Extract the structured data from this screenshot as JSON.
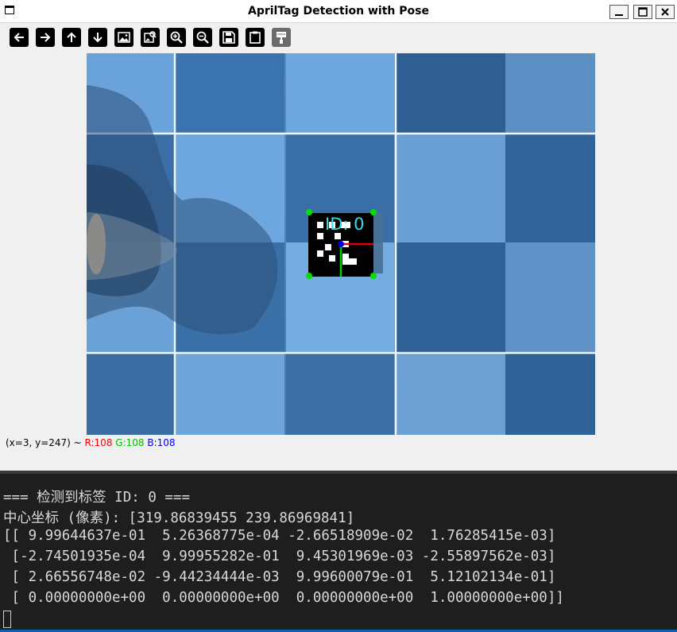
{
  "window": {
    "title": "AprilTag Detection with Pose",
    "controls": [
      "minimize",
      "maximize",
      "close"
    ]
  },
  "toolbar": {
    "buttons": [
      {
        "id": "pan-left",
        "icon": "arrow-left-icon",
        "enabled": true
      },
      {
        "id": "pan-right",
        "icon": "arrow-right-icon",
        "enabled": true
      },
      {
        "id": "pan-up",
        "icon": "arrow-up-icon",
        "enabled": true
      },
      {
        "id": "pan-down",
        "icon": "arrow-down-icon",
        "enabled": true
      },
      {
        "id": "zoom-fit",
        "icon": "image-icon",
        "enabled": true
      },
      {
        "id": "zoom-original",
        "icon": "image-search-icon",
        "enabled": true
      },
      {
        "id": "zoom-in",
        "icon": "zoom-in-icon",
        "enabled": true
      },
      {
        "id": "zoom-out",
        "icon": "zoom-out-icon",
        "enabled": true
      },
      {
        "id": "save",
        "icon": "save-icon",
        "enabled": true
      },
      {
        "id": "copy",
        "icon": "clipboard-icon",
        "enabled": true
      },
      {
        "id": "properties",
        "icon": "paint-brush-icon",
        "enabled": false
      }
    ]
  },
  "image": {
    "tag_label": "ID: 0",
    "colors": {
      "corner": "#00e000",
      "axis_x": "#e00000",
      "axis_y": "#00d000",
      "axis_z": "#0000e0",
      "label": "#33ddee"
    }
  },
  "status": {
    "coords": "(x=3, y=247) ~ ",
    "r": "R:108",
    "g": "G:108",
    "b": "B:108",
    "colors": {
      "r": "#ff0000",
      "g": "#00c000",
      "b": "#0000ff"
    }
  },
  "terminal": {
    "lines": [
      "=== 检测到标签 ID: 0 ===",
      "中心坐标 (像素): [319.86839455 239.86969841]",
      "[[ 9.99644637e-01  5.26368775e-04 -2.66518909e-02  1.76285415e-03]",
      " [-2.74501935e-04  9.99955282e-01  9.45301969e-03 -2.55897562e-03]",
      " [ 2.66556748e-02 -9.44234444e-03  9.99600079e-01  5.12102134e-01]",
      " [ 0.00000000e+00  0.00000000e+00  0.00000000e+00  1.00000000e+00]]"
    ]
  }
}
